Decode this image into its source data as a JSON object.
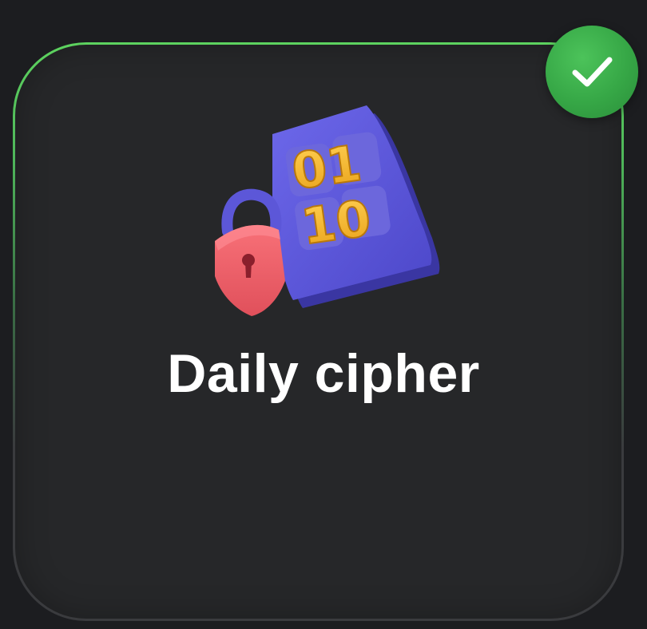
{
  "card": {
    "title": "Daily cipher",
    "status": "completed",
    "icon": "cipher-lock-icon",
    "badge_icon": "checkmark-icon"
  },
  "illustration": {
    "digits_top": "01",
    "digits_bottom": "10"
  },
  "colors": {
    "accent": "#5dd35f",
    "badge": "#36a746",
    "card_background": "#262729",
    "page_background": "#1c1d20",
    "paper": "#5a55d6",
    "lock": "#f0606a",
    "digits": "#f3b22a"
  }
}
